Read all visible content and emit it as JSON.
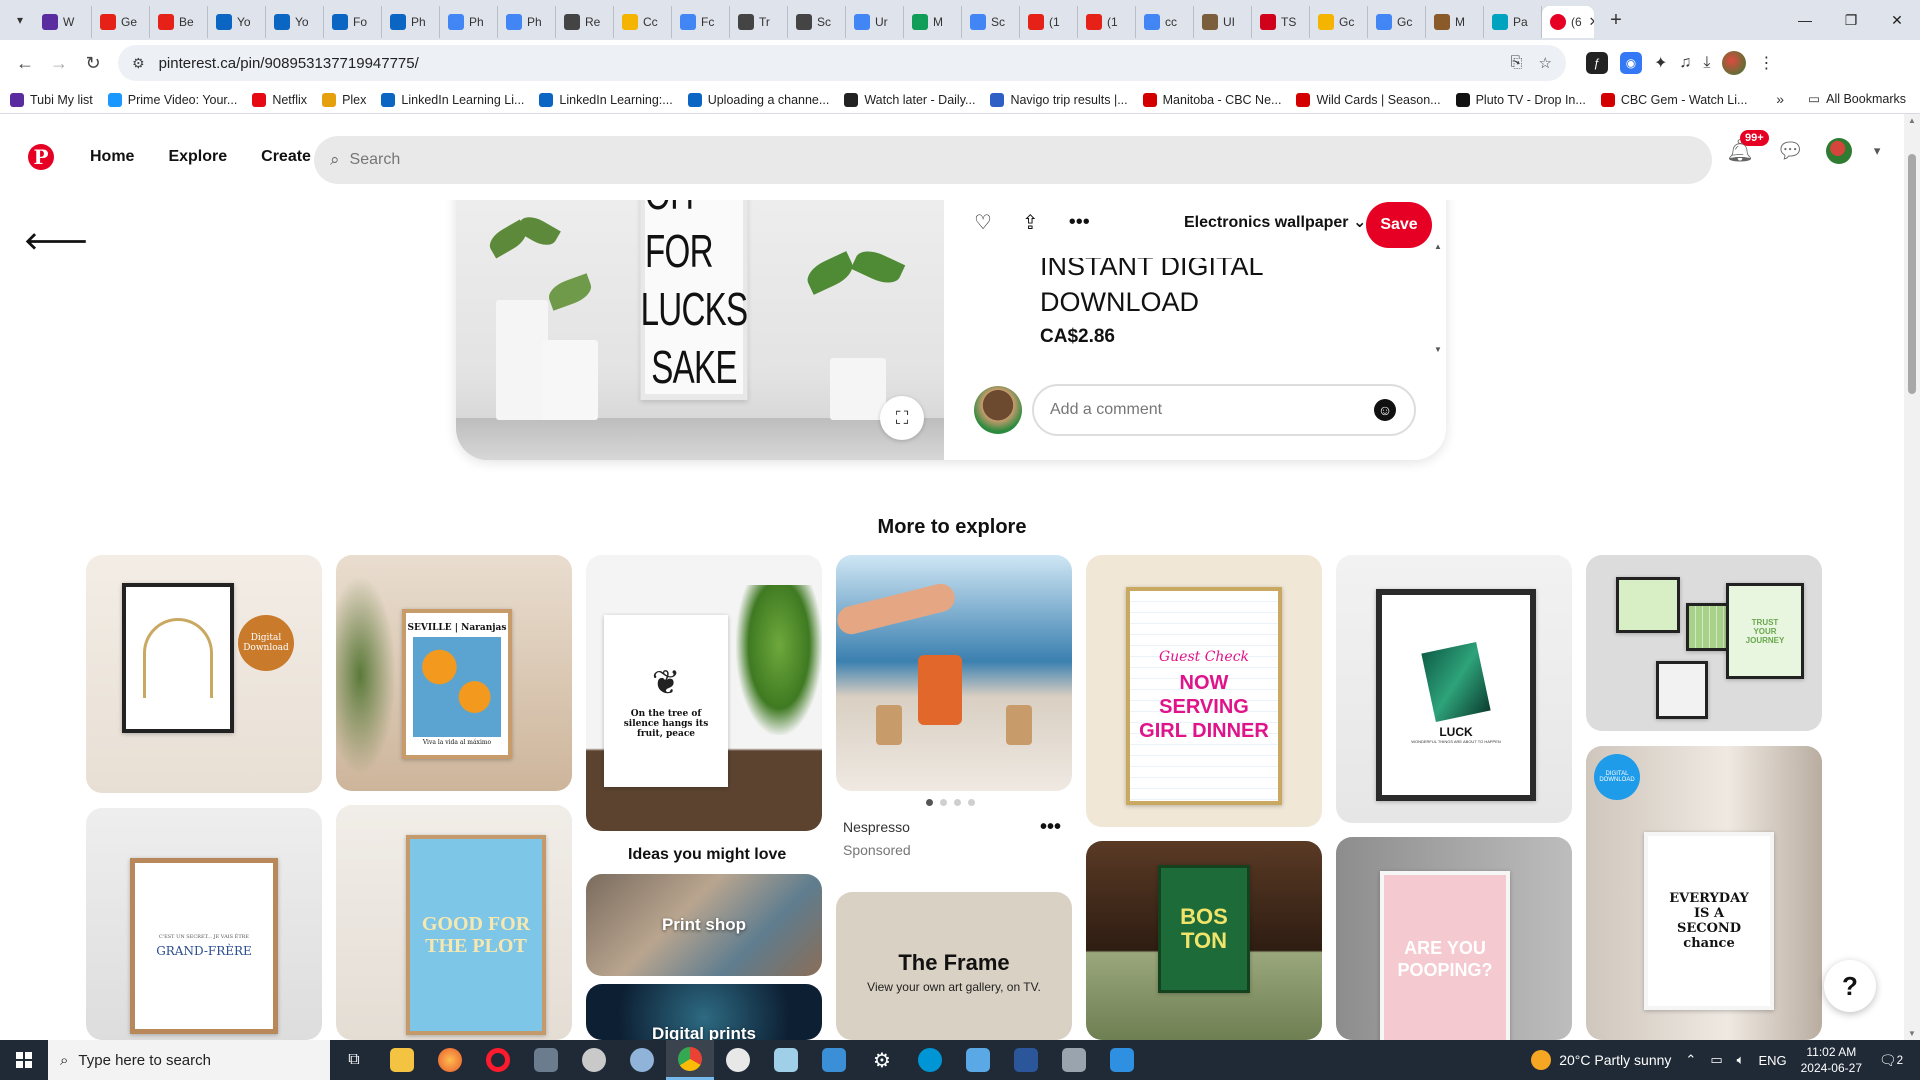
{
  "browser": {
    "tabs": [
      {
        "label": "W",
        "color": "#5a2ca0"
      },
      {
        "label": "Ge",
        "color": "#e62117"
      },
      {
        "label": "Be",
        "color": "#e62117"
      },
      {
        "label": "Yo",
        "color": "#0a66c2"
      },
      {
        "label": "Yo",
        "color": "#0a66c2"
      },
      {
        "label": "Fo",
        "color": "#0a66c2"
      },
      {
        "label": "Ph",
        "color": "#0a66c2"
      },
      {
        "label": "Ph",
        "color": "#4285f4"
      },
      {
        "label": "Ph",
        "color": "#4285f4"
      },
      {
        "label": "Re",
        "color": "#444444"
      },
      {
        "label": "Cc",
        "color": "#f4b400"
      },
      {
        "label": "Fc",
        "color": "#4285f4"
      },
      {
        "label": "Tr",
        "color": "#444444"
      },
      {
        "label": "Sc",
        "color": "#444444"
      },
      {
        "label": "Ur",
        "color": "#4285f4"
      },
      {
        "label": "M",
        "color": "#0f9d58"
      },
      {
        "label": "Sc",
        "color": "#4285f4"
      },
      {
        "label": "(1",
        "color": "#e62117"
      },
      {
        "label": "(1",
        "color": "#e62117"
      },
      {
        "label": "cc",
        "color": "#4285f4"
      },
      {
        "label": "UI",
        "color": "#7b5e3b"
      },
      {
        "label": "TS",
        "color": "#d0021b"
      },
      {
        "label": "Gc",
        "color": "#f4b400"
      },
      {
        "label": "Gc",
        "color": "#4285f4"
      },
      {
        "label": "M",
        "color": "#8b5a2b"
      },
      {
        "label": "Pa",
        "color": "#00a3bf"
      },
      {
        "label": "(6",
        "color": "#e60023"
      }
    ],
    "active_tab_icon": "pinterest-icon",
    "active_tab_color": "#e60023",
    "url": "pinterest.ca/pin/908953137719947775/",
    "bookmarks": [
      {
        "label": "Tubi My list",
        "color": "#5a2ca0"
      },
      {
        "label": "Prime Video: Your...",
        "color": "#1a98ff"
      },
      {
        "label": "Netflix",
        "color": "#e50914"
      },
      {
        "label": "Plex",
        "color": "#e5a00d"
      },
      {
        "label": "LinkedIn Learning Li...",
        "color": "#0a66c2"
      },
      {
        "label": "LinkedIn Learning:...",
        "color": "#0a66c2"
      },
      {
        "label": "Uploading a channe...",
        "color": "#0a66c2"
      },
      {
        "label": "Watch later - Daily...",
        "color": "#222222"
      },
      {
        "label": "Navigo trip results |...",
        "color": "#2d5fc4"
      },
      {
        "label": "Manitoba - CBC Ne...",
        "color": "#d40000"
      },
      {
        "label": "Wild Cards | Season...",
        "color": "#d40000"
      },
      {
        "label": "Pluto TV - Drop In...",
        "color": "#111111"
      },
      {
        "label": "CBC Gem - Watch Li...",
        "color": "#d40000"
      }
    ],
    "all_bookmarks": "All Bookmarks"
  },
  "header": {
    "nav": [
      "Home",
      "Explore",
      "Create"
    ],
    "search_placeholder": "Search",
    "notification_count": "99+",
    "brand_color": "#e60023"
  },
  "pin": {
    "poster_lines": [
      "OH FOR",
      "LUCKS",
      "SAKE"
    ],
    "board": "Electronics wallpaper",
    "save_label": "Save",
    "title": "INSTANT DIGITAL DOWNLOAD",
    "price": "CA$2.86",
    "comment_placeholder": "Add a comment"
  },
  "explore": {
    "title": "More to explore",
    "pins": [
      {
        "caption": "Digital Download"
      },
      {
        "caption": "SEVILLE | Naranjas",
        "sub": "Viva la vida al máximo"
      },
      {
        "caption": "On the tree of silence hangs its fruit, peace"
      },
      {
        "caption": ""
      },
      {
        "caption": "NOW SERVING GIRL DINNER",
        "sub": "Guest Check"
      },
      {
        "caption": "LUCK",
        "sub": "WONDERFUL THINGS ARE ABOUT TO HAPPEN"
      },
      {
        "caption": "TRUST YOUR JOURNEY"
      },
      {
        "caption": "GRAND-FRÈRE",
        "sub": "C'EST UN SECRET... JE VAIS ÊTRE"
      },
      {
        "caption": "GOOD FOR THE PLOT"
      },
      {
        "caption": "The Frame",
        "sub": "View your own art gallery, on TV."
      },
      {
        "caption": "BOS TON"
      },
      {
        "caption": "ARE YOU POOPING?"
      },
      {
        "caption": "EVERYDAY IS A SECOND chance",
        "sub": "DIGITAL DOWNLOAD"
      }
    ],
    "sponsored_brand": "Nespresso",
    "sponsored_label": "Sponsored",
    "ideas_title": "Ideas you might love",
    "ideas": [
      "Print shop",
      "Digital prints"
    ]
  },
  "taskbar": {
    "search_placeholder": "Type here to search",
    "weather": "20°C  Partly sunny",
    "lang": "ENG",
    "time": "11:02 AM",
    "date": "2024-06-27",
    "notifications": "2"
  }
}
